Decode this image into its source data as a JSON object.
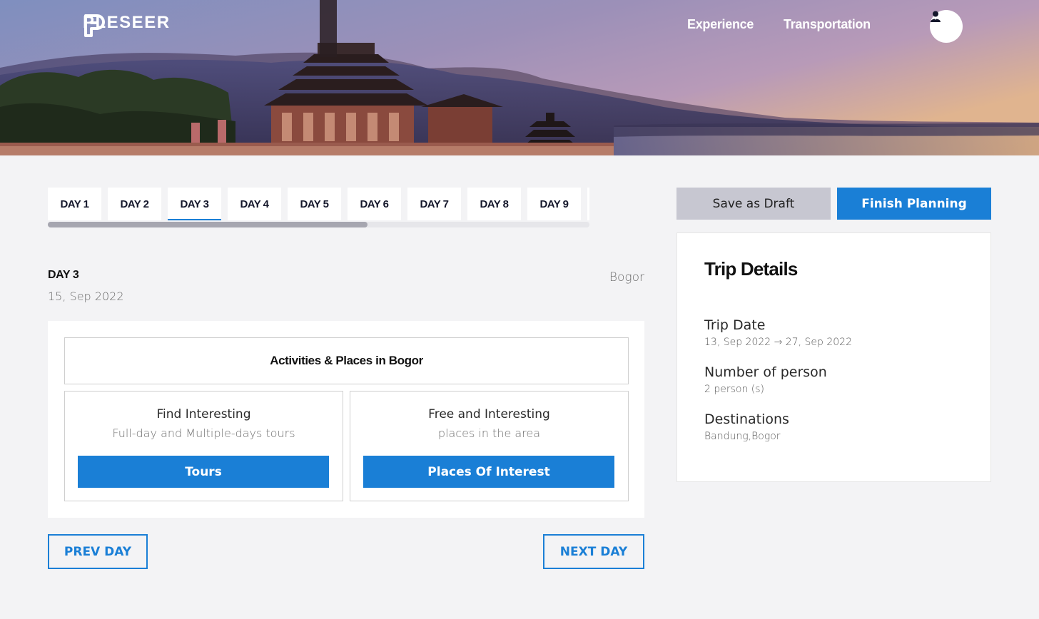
{
  "brand": {
    "name": "PLESEER"
  },
  "nav": {
    "experience": "Experience",
    "transportation": "Transportation"
  },
  "icons": {
    "logo": "pleseer-logo-icon",
    "avatar": "user-icon"
  },
  "colors": {
    "accent": "#1a7fd6",
    "draft": "#c7c7d1",
    "background": "#f3f3f5"
  },
  "tabs": [
    {
      "label": "DAY 1"
    },
    {
      "label": "DAY 2"
    },
    {
      "label": "DAY 3",
      "active": true
    },
    {
      "label": "DAY 4"
    },
    {
      "label": "DAY 5"
    },
    {
      "label": "DAY 6"
    },
    {
      "label": "DAY 7"
    },
    {
      "label": "DAY 8"
    },
    {
      "label": "DAY 9"
    }
  ],
  "day": {
    "title": "DAY 3",
    "date": "15, Sep 2022",
    "city": "Bogor"
  },
  "activities": {
    "heading": "Activities & Places in Bogor",
    "tours": {
      "title": "Find Interesting",
      "subtitle": "Full-day and Multiple-days tours",
      "button": "Tours"
    },
    "places": {
      "title": "Free and Interesting",
      "subtitle": "places in the area",
      "button": "Places Of Interest"
    }
  },
  "navigation": {
    "prev": "PREV DAY",
    "next": "NEXT DAY"
  },
  "actions": {
    "draft": "Save as Draft",
    "finish": "Finish Planning"
  },
  "trip": {
    "title": "Trip Details",
    "date_label": "Trip Date",
    "date_value": "13, Sep 2022 → 27, Sep 2022",
    "persons_label": "Number of person",
    "persons_value": "2 person (s)",
    "destinations_label": "Destinations",
    "destinations_value": "Bandung,Bogor"
  }
}
